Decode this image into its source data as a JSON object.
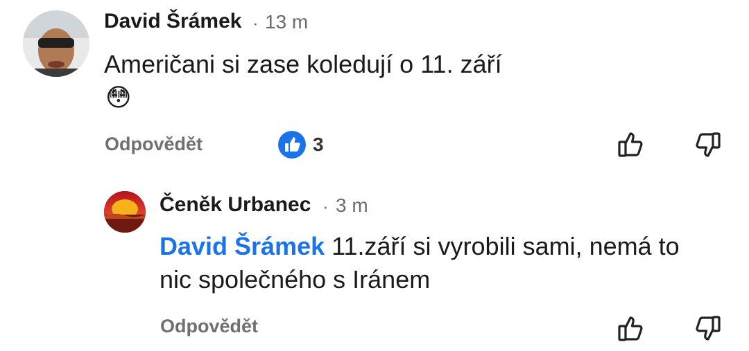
{
  "comment": {
    "author": "David Šrámek",
    "separator": "·",
    "time": "13 m",
    "text": "Američani si zase koledují o 11. září",
    "emoji": "😳",
    "reply_label": "Odpovědět",
    "like_count": "3"
  },
  "reply": {
    "author": "Čeněk Urbanec",
    "separator": "·",
    "time": "3 m",
    "mention": "David Šrámek",
    "text_line1": "11.září si vyrobili sami, nemá to",
    "text_line2": "nic společného s Iránem",
    "reply_label": "Odpovědět"
  },
  "colors": {
    "mention": "#1a73e8",
    "like_badge": "#1a73e8",
    "secondary_text": "#707070"
  }
}
